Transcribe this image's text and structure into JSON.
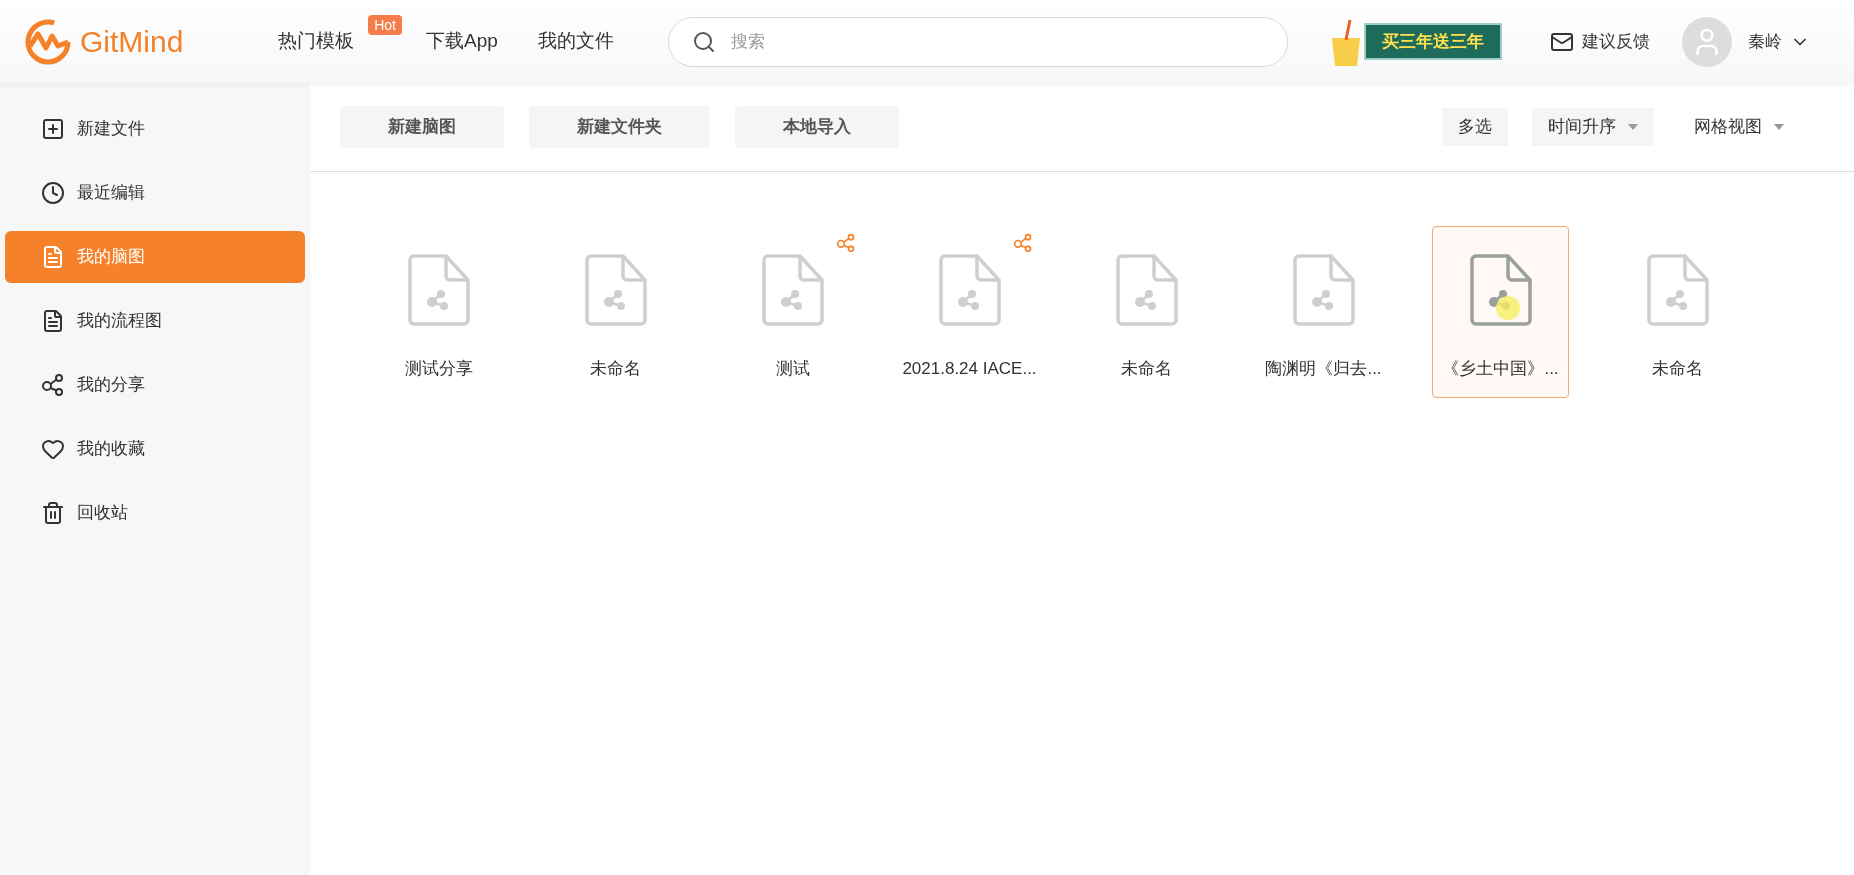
{
  "header": {
    "logo": "GitMind",
    "nav": [
      {
        "label": "热门模板",
        "badge": "Hot"
      },
      {
        "label": "下载App"
      },
      {
        "label": "我的文件"
      }
    ],
    "search": {
      "placeholder": "搜索"
    },
    "promo": "买三年送三年",
    "feedback": "建议反馈",
    "user": "秦岭"
  },
  "sidebar": {
    "items": [
      {
        "label": "新建文件",
        "kind": "new",
        "selected": false
      },
      {
        "label": "最近编辑",
        "kind": "recent",
        "selected": false
      },
      {
        "label": "我的脑图",
        "kind": "list",
        "selected": true
      },
      {
        "label": "我的流程图",
        "kind": "list",
        "selected": false
      },
      {
        "label": "我的分享",
        "kind": "share",
        "selected": false
      },
      {
        "label": "我的收藏",
        "kind": "favorite",
        "selected": false
      },
      {
        "label": "回收站",
        "kind": "trash",
        "selected": false
      }
    ]
  },
  "toolbar": {
    "buttons": [
      "新建脑图",
      "新建文件夹",
      "本地导入"
    ],
    "multi_select": "多选",
    "sort": "时间升序",
    "view": "网格视图"
  },
  "files": [
    {
      "name": "测试分享",
      "shared": false,
      "selected": false
    },
    {
      "name": "未命名",
      "shared": false,
      "selected": false
    },
    {
      "name": "测试",
      "shared": true,
      "selected": false
    },
    {
      "name": "2021.8.24 IACE...",
      "shared": true,
      "selected": false
    },
    {
      "name": "未命名",
      "shared": false,
      "selected": false
    },
    {
      "name": "陶渊明《归去...",
      "shared": false,
      "selected": false
    },
    {
      "name": "《乡土中国》...",
      "shared": false,
      "selected": true
    },
    {
      "name": "未命名",
      "shared": false,
      "selected": false
    }
  ]
}
